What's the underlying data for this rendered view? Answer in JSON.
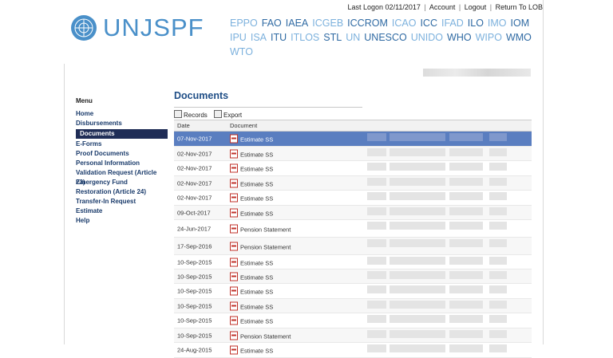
{
  "header": {
    "last_logon": "Last Logon 02/11/2017",
    "account": "Account",
    "logout": "Logout",
    "return": "Return To LOB",
    "logo": "UNJSPF",
    "orgs": [
      {
        "t": "EPPO",
        "s": "light"
      },
      {
        "t": "FAO",
        "s": "dark"
      },
      {
        "t": "IAEA",
        "s": "dark"
      },
      {
        "t": "ICGEB",
        "s": "light"
      },
      {
        "t": "ICCROM",
        "s": "dark"
      },
      {
        "t": "ICAO",
        "s": "light"
      },
      {
        "t": "ICC",
        "s": "dark"
      },
      {
        "t": "IFAD",
        "s": "light"
      },
      {
        "t": "ILO",
        "s": "dark"
      },
      {
        "t": "IMO",
        "s": "light"
      },
      {
        "t": "IOM",
        "s": "dark"
      },
      {
        "t": "IPU",
        "s": "light"
      },
      {
        "t": "ISA",
        "s": "light"
      },
      {
        "t": "ITU",
        "s": "dark"
      },
      {
        "t": "ITLOS",
        "s": "light"
      },
      {
        "t": "STL",
        "s": "dark"
      },
      {
        "t": "UN",
        "s": "light"
      },
      {
        "t": "UNESCO",
        "s": "dark"
      },
      {
        "t": "UNIDO",
        "s": "light"
      },
      {
        "t": "WHO",
        "s": "dark"
      },
      {
        "t": "WIPO",
        "s": "light"
      },
      {
        "t": "WMO",
        "s": "dark"
      },
      {
        "t": "WTO",
        "s": "light"
      }
    ]
  },
  "menu": {
    "title": "Menu",
    "items": [
      "Home",
      "Disbursements",
      "Documents",
      "E-Forms",
      "Proof Documents",
      "Personal Information",
      "Validation Request (Article 23)",
      "Emergency Fund",
      "Restoration (Article 24)",
      "Transfer-In Request",
      "Estimate",
      "Help"
    ],
    "active_index": 2
  },
  "documents": {
    "title": "Documents",
    "toolbar": {
      "records": "Records",
      "export": "Export"
    },
    "columns": {
      "date": "Date",
      "document": "Document"
    },
    "rows": [
      {
        "date": "07-Nov-2017",
        "doc": "Estimate SS"
      },
      {
        "date": "02-Nov-2017",
        "doc": "Estimate SS"
      },
      {
        "date": "02-Nov-2017",
        "doc": "Estimate SS"
      },
      {
        "date": "02-Nov-2017",
        "doc": "Estimate SS"
      },
      {
        "date": "02-Nov-2017",
        "doc": "Estimate SS"
      },
      {
        "date": "09-Oct-2017",
        "doc": "Estimate SS"
      },
      {
        "date": "24-Jun-2017",
        "doc": "Pension Statement"
      },
      {
        "date": "17-Sep-2016",
        "doc": "Pension Statement"
      },
      {
        "date": "10-Sep-2015",
        "doc": "Estimate SS"
      },
      {
        "date": "10-Sep-2015",
        "doc": "Estimate SS"
      },
      {
        "date": "10-Sep-2015",
        "doc": "Estimate SS"
      },
      {
        "date": "10-Sep-2015",
        "doc": "Estimate SS"
      },
      {
        "date": "10-Sep-2015",
        "doc": "Estimate SS"
      },
      {
        "date": "10-Sep-2015",
        "doc": "Pension Statement"
      },
      {
        "date": "24-Aug-2015",
        "doc": "Estimate SS"
      }
    ],
    "selected_index": 0
  },
  "colors": {
    "accent": "#1f4e86",
    "menu_active": "#1f2d56",
    "row_selected": "#5a7ec0",
    "logo": "#4a90c9"
  }
}
